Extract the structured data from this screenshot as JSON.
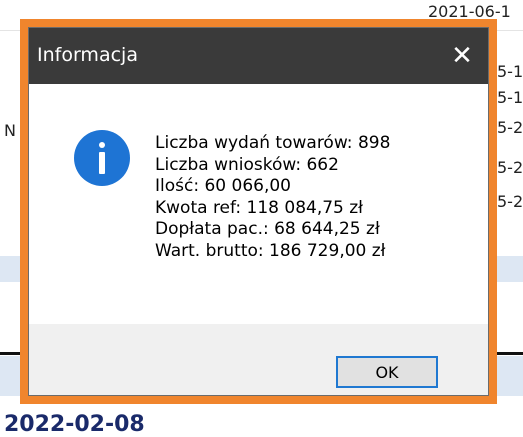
{
  "background": {
    "fragments": [
      "2021-06-1",
      "5-1",
      "5-1",
      "5-2",
      "5-2",
      "5-2",
      "N"
    ],
    "bottom_date": "2022-02-08"
  },
  "dialog": {
    "title": "Informacja",
    "close_glyph": "✕",
    "icon": "info-icon",
    "lines": [
      "Liczba wydań towarów: 898",
      "Liczba wniosków: 662",
      "Ilość: 60 066,00",
      "Kwota ref: 118 084,75 zł",
      "Dopłata pac.: 68 644,25 zł",
      "Wart. brutto: 186 729,00 zł"
    ],
    "ok_label": "OK"
  },
  "colors": {
    "frame": "#f0852d",
    "titlebar": "#3a3a3a",
    "info_icon": "#1e74d4",
    "ok_border": "#1f78d1"
  }
}
